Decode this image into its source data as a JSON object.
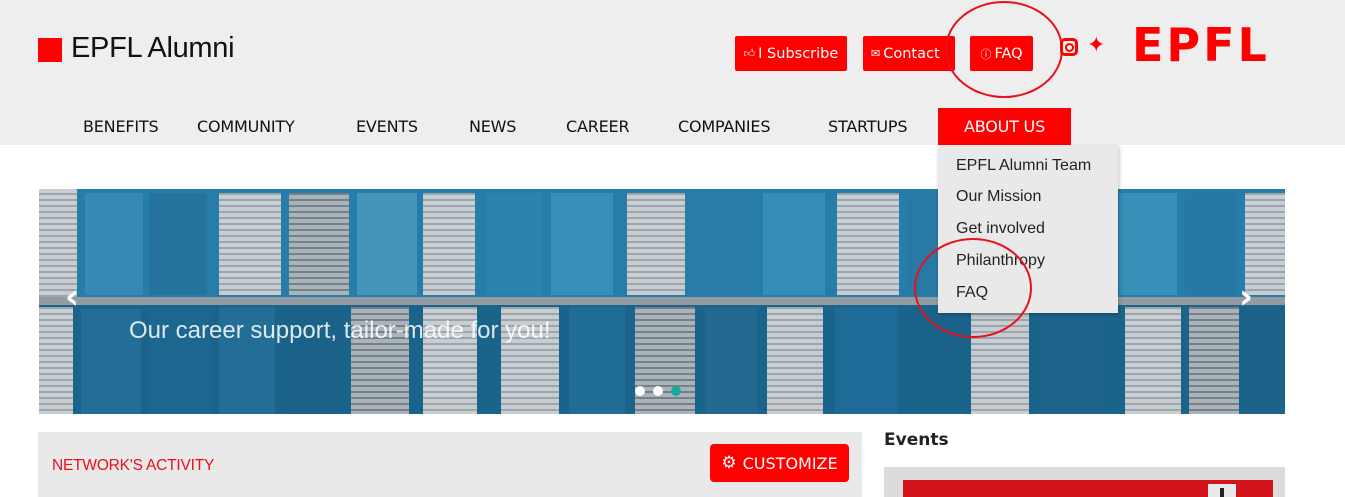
{
  "brand": {
    "name": "EPFL Alumni",
    "partner_logo": "EPFL",
    "accent": "#ff0000",
    "annotation_color": "#e8101e"
  },
  "top_buttons": {
    "subscribe": {
      "label": "I Subscribe",
      "icon": "thumbs-up-icon"
    },
    "contact": {
      "label": "Contact",
      "icon": "envelope-icon"
    },
    "faq": {
      "label": "FAQ",
      "icon": "question-circle-icon"
    }
  },
  "social": [
    "instagram-icon",
    "twitter-icon"
  ],
  "nav": {
    "items": [
      {
        "label": "BENEFITS"
      },
      {
        "label": "COMMUNITY"
      },
      {
        "label": "EVENTS"
      },
      {
        "label": "NEWS"
      },
      {
        "label": "CAREER"
      },
      {
        "label": "COMPANIES"
      },
      {
        "label": "STARTUPS"
      },
      {
        "label": "ABOUT US",
        "active": true
      }
    ]
  },
  "about_dropdown": {
    "items": [
      {
        "label": "EPFL Alumni Team"
      },
      {
        "label": "Our Mission"
      },
      {
        "label": "Get involved"
      },
      {
        "label": "Philanthropy"
      },
      {
        "label": "FAQ"
      }
    ]
  },
  "hero": {
    "caption": "Our career support, tailor-made for you!",
    "prev_icon": "chevron-left-icon",
    "next_icon": "chevron-right-icon",
    "slide_count": 3,
    "active_slide": 2
  },
  "activity": {
    "title": "NETWORK'S ACTIVITY",
    "customize_label": "CUSTOMIZE"
  },
  "events": {
    "title": "Events"
  }
}
